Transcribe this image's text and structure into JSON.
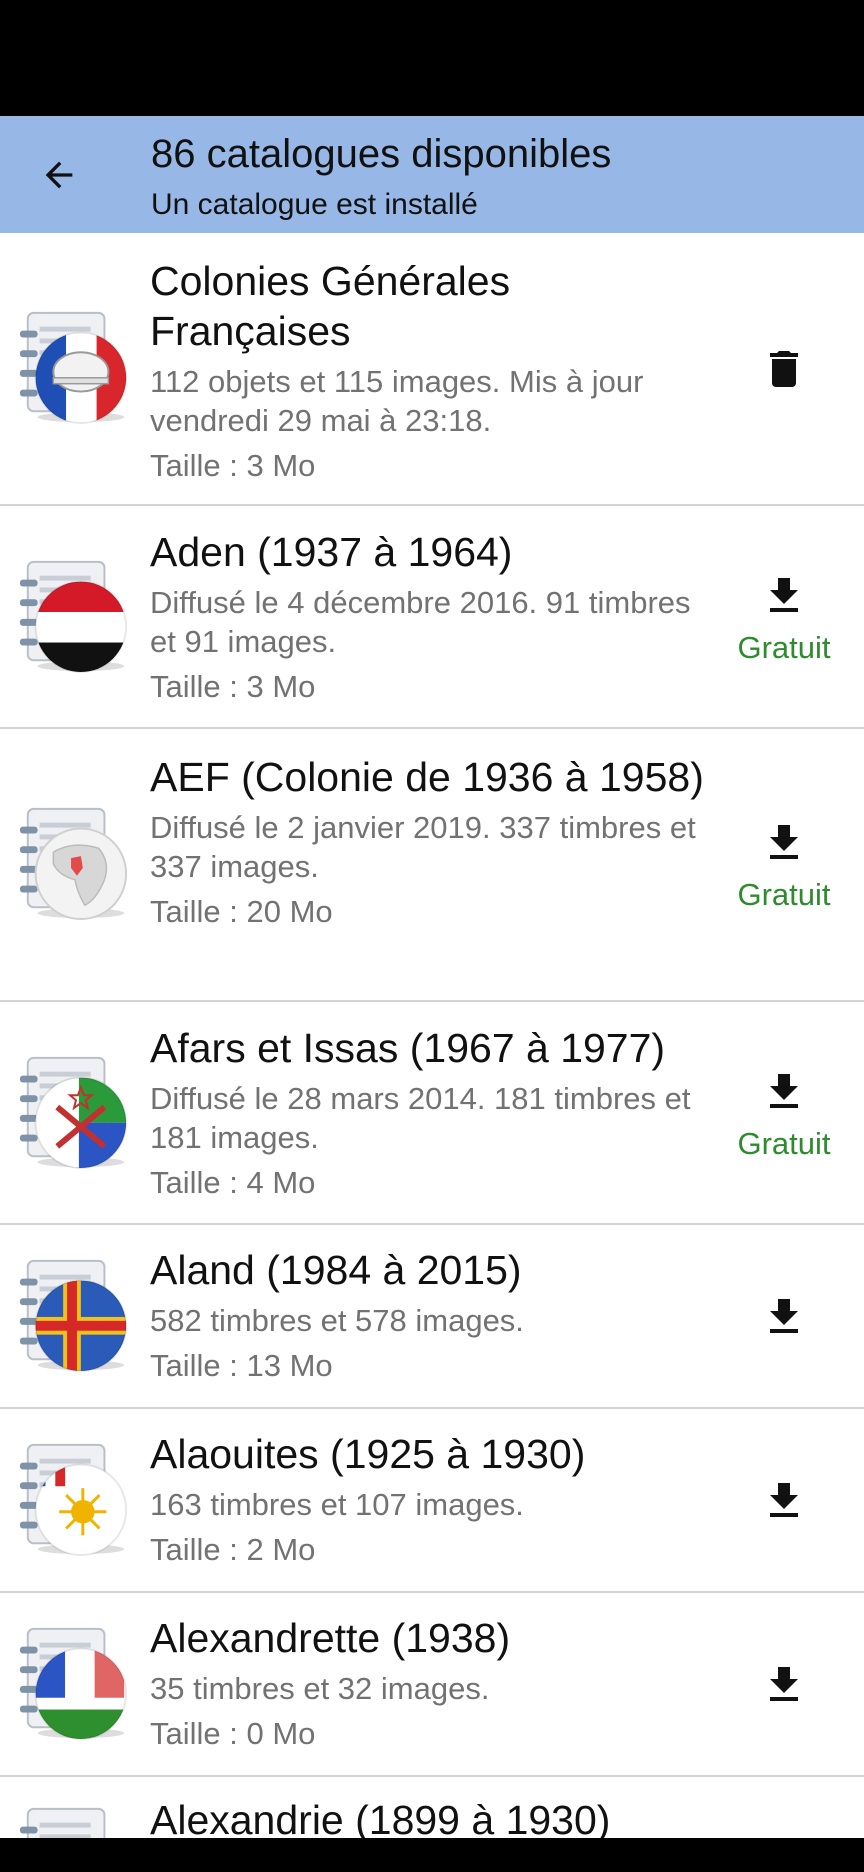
{
  "app_bar": {
    "title": "86 catalogues disponibles",
    "subtitle": "Un catalogue est installé",
    "back_icon": "arrow-left-icon"
  },
  "catalogues": [
    {
      "name": "Colonies Générales Françaises",
      "description": "112 objets et 115 images. Mis à jour vendredi 29 mai à 23:18.",
      "size": "Taille : 3 Mo",
      "action_icon": "trash-icon",
      "price": ""
    },
    {
      "name": "Aden (1937 à 1964)",
      "description": "Diffusé le 4 décembre 2016. 91 timbres et 91 images.",
      "size": "Taille : 3 Mo",
      "action_icon": "download-icon",
      "price": "Gratuit"
    },
    {
      "name": "AEF (Colonie de 1936 à 1958)",
      "description": "Diffusé le 2 janvier 2019. 337 timbres et 337 images.",
      "size": "Taille : 20 Mo",
      "action_icon": "download-icon",
      "price": "Gratuit"
    },
    {
      "name": "Afars et Issas (1967 à 1977)",
      "description": "Diffusé le 28 mars 2014. 181 timbres et 181 images.",
      "size": "Taille : 4 Mo",
      "action_icon": "download-icon",
      "price": "Gratuit"
    },
    {
      "name": "Aland (1984 à 2015)",
      "description": "582 timbres et 578 images.",
      "size": "Taille : 13 Mo",
      "action_icon": "download-icon",
      "price": ""
    },
    {
      "name": "Alaouites (1925 à 1930)",
      "description": "163 timbres et 107 images.",
      "size": "Taille : 2 Mo",
      "action_icon": "download-icon",
      "price": ""
    },
    {
      "name": "Alexandrette (1938)",
      "description": "35 timbres et 32 images.",
      "size": "Taille : 0 Mo",
      "action_icon": "download-icon",
      "price": ""
    },
    {
      "name": "Alexandrie (1899 à 1930)",
      "description": "",
      "size": "",
      "action_icon": "",
      "price": ""
    }
  ],
  "colors": {
    "app_bar": "#97b8e6",
    "price_green": "#2e8b2e",
    "secondary_text": "#727272"
  }
}
